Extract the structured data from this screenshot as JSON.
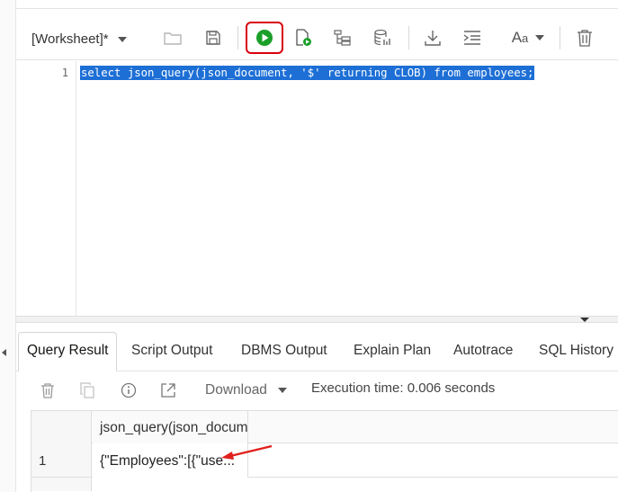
{
  "toolbar": {
    "worksheet_label": "[Worksheet]*",
    "icons": [
      "open-folder-icon",
      "save-icon",
      "run-statement-icon",
      "run-script-icon",
      "explain-plan-icon",
      "autotrace-icon",
      "download-icon",
      "format-icon",
      "font-size-icon",
      "clear-icon"
    ],
    "run_highlight_color": "#d9000d",
    "run_icon_color": "#1a9f29"
  },
  "editor": {
    "line_number": "1",
    "code": "select json_query(json_document, '$' returning CLOB) from employees;",
    "selection_color": "#1d6fd6"
  },
  "results": {
    "tabs": [
      "Query Result",
      "Script Output",
      "DBMS Output",
      "Explain Plan",
      "Autotrace",
      "SQL History"
    ],
    "active_tab": "Query Result",
    "download_label": "Download",
    "execution_time": "Execution time: 0.006 seconds",
    "grid": {
      "columns": [
        "json_query(json_docum"
      ],
      "rows": [
        {
          "num": "1",
          "value": "{\"Employees\":[{\"use..."
        }
      ]
    },
    "annotation_arrow_color": "#e0201c"
  }
}
